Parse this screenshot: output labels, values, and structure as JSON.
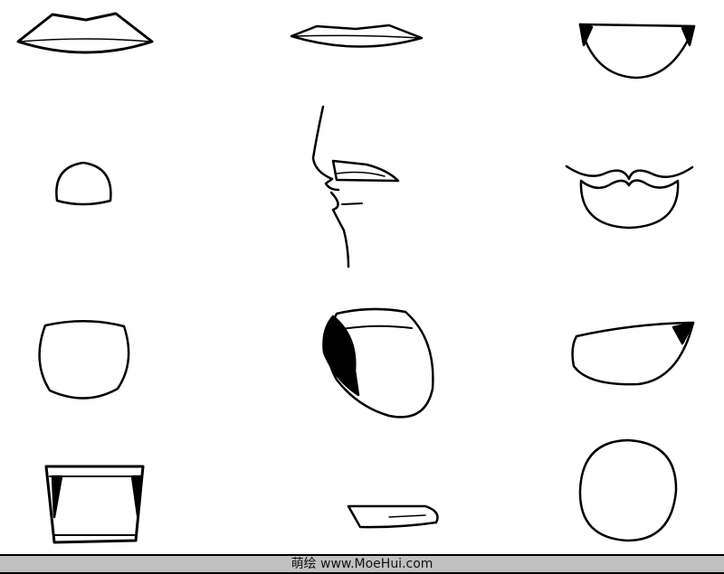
{
  "footer": {
    "caption": "萌绘 www.MoeHui.com"
  },
  "colors": {
    "ink": "#000000",
    "footer_bg": "#c0c0c0"
  }
}
